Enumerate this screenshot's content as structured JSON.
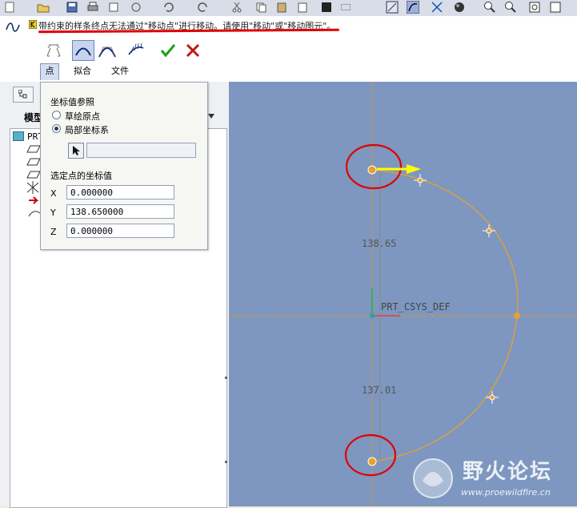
{
  "message": {
    "text": "带约束的样条终点无法通过\"移动点\"进行移动。请使用\"移动\"或\"移动图元\"。"
  },
  "dashboard": {
    "tabs": [
      {
        "label": "点"
      },
      {
        "label": "拟合"
      },
      {
        "label": "文件"
      }
    ],
    "active_tab": "点"
  },
  "left_panel": {
    "model_tree_label": "模型",
    "tree_root": "PRT"
  },
  "popup": {
    "section_ref_title": "坐标值参照",
    "options": [
      {
        "label": "草绘原点",
        "selected": false
      },
      {
        "label": "局部坐标系",
        "selected": true
      }
    ],
    "section_coords_title": "选定点的坐标值",
    "coords": [
      {
        "axis": "X",
        "value": "0.000000"
      },
      {
        "axis": "Y",
        "value": "138.650000"
      },
      {
        "axis": "Z",
        "value": "0.000000"
      }
    ]
  },
  "canvas": {
    "dim_top": "138.65",
    "dim_bottom": "137.01",
    "csys_label": "PRT_CSYS_DEF"
  },
  "watermark": {
    "text": "野火论坛",
    "url": "www.proewildfire.cn"
  },
  "colors": {
    "canvas_bg": "#7d97c0",
    "spline": "#e8a030",
    "dim_line": "#c89050",
    "annotation": "#e00000",
    "arrow": "#ffff00",
    "accept": "#1ba01b",
    "cancel": "#c01818"
  }
}
